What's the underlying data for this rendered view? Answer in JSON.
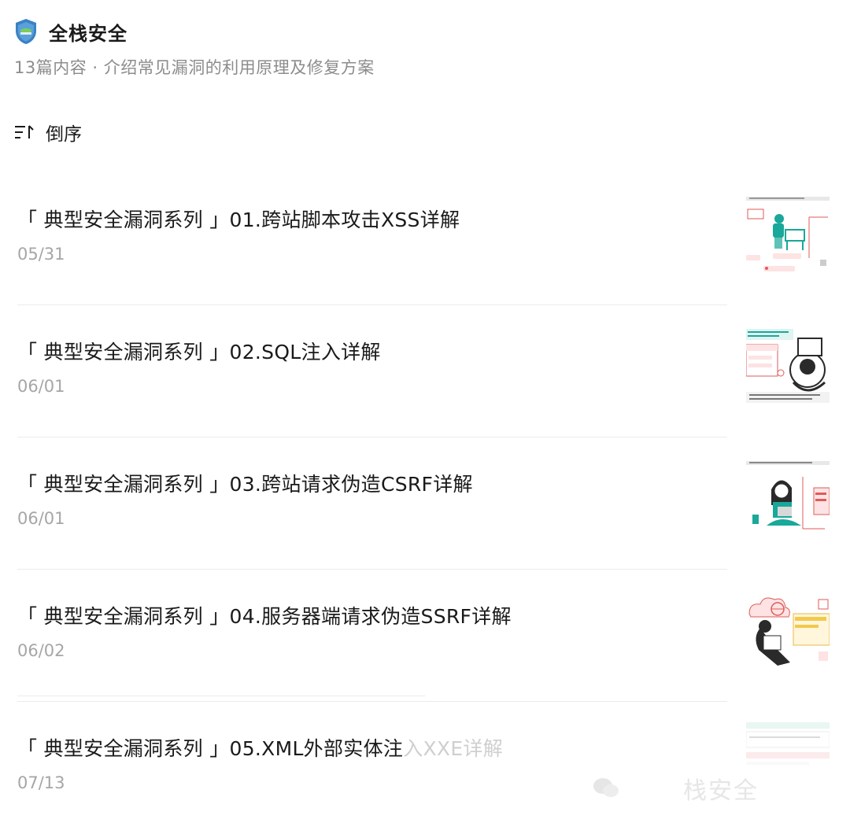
{
  "account": {
    "name": "全栈安全",
    "subtitle": "13篇内容 · 介绍常见漏洞的利用原理及修复方案",
    "logo_icon": "shield-logo-icon",
    "brand_color": "#3b82c4"
  },
  "sort": {
    "icon": "sort-desc-icon",
    "label": "倒序"
  },
  "articles": [
    {
      "title": "「 典型安全漏洞系列 」01.跨站脚本攻击XSS详解",
      "date": "05/31",
      "thumb": "xss-illustration"
    },
    {
      "title": "「 典型安全漏洞系列 」02.SQL注入详解",
      "date": "06/01",
      "thumb": "sql-injection-illustration"
    },
    {
      "title": "「 典型安全漏洞系列 」03.跨站请求伪造CSRF详解",
      "date": "06/01",
      "thumb": "csrf-illustration"
    },
    {
      "title": "「 典型安全漏洞系列 」04.服务器端请求伪造SSRF详解",
      "date": "06/02",
      "thumb": "ssrf-illustration"
    },
    {
      "title_main": "「 典型安全漏洞系列 」05.XML外部实体注",
      "title_fade": "入XXE详解",
      "date": "07/13",
      "thumb": "xxe-illustration"
    }
  ],
  "watermark": {
    "icon": "wechat-icon",
    "text": "栈安全"
  },
  "colors": {
    "text": "#1a1a1a",
    "muted": "#8c8c8c",
    "date": "#a6a6a6",
    "accent_teal": "#19a89a",
    "accent_red": "#e05a5a"
  }
}
